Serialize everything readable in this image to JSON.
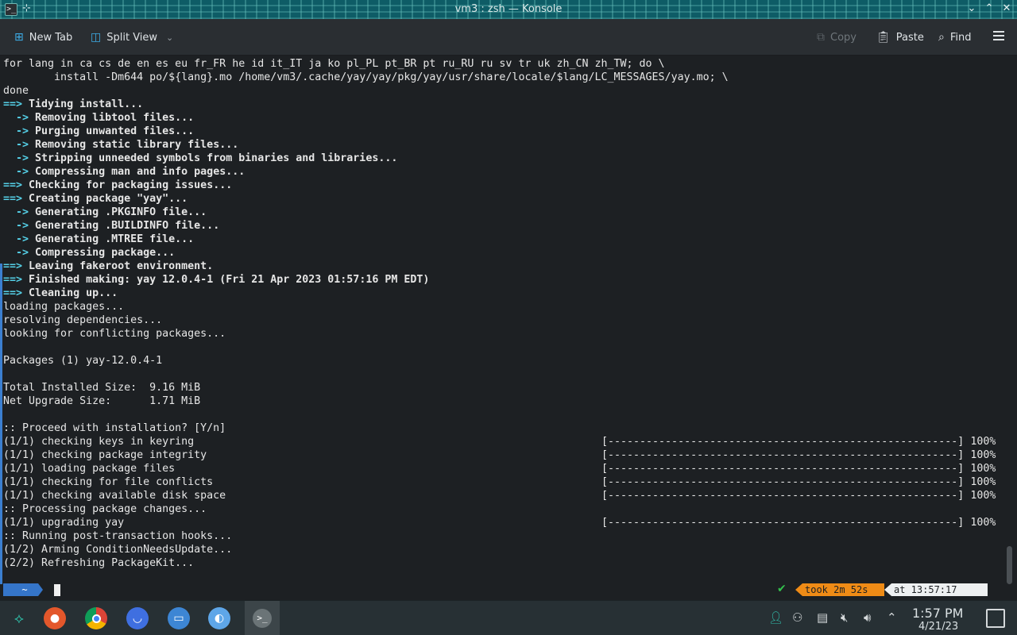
{
  "window": {
    "icon": ">_",
    "title": "vm3 : zsh — Konsole"
  },
  "toolbar": {
    "new_tab": "New Tab",
    "split_view": "Split View",
    "copy": "Copy",
    "paste": "Paste",
    "find": "Find"
  },
  "terminal": {
    "lines": [
      {
        "t": "plain",
        "text": "for lang in ca cs de en es eu fr_FR he id it_IT ja ko pl_PL pt_BR pt ru_RU ru sv tr uk zh_CN zh_TW; do \\"
      },
      {
        "t": "plain",
        "text": "        install -Dm644 po/${lang}.mo /home/vm3/.cache/yay/yay/pkg/yay/usr/share/locale/$lang/LC_MESSAGES/yay.mo; \\"
      },
      {
        "t": "plain",
        "text": "done"
      },
      {
        "t": "main",
        "marker": "==>",
        "text": " Tidying install..."
      },
      {
        "t": "sub",
        "marker": "  ->",
        "text": " Removing libtool files..."
      },
      {
        "t": "sub",
        "marker": "  ->",
        "text": " Purging unwanted files..."
      },
      {
        "t": "sub",
        "marker": "  ->",
        "text": " Removing static library files..."
      },
      {
        "t": "sub",
        "marker": "  ->",
        "text": " Stripping unneeded symbols from binaries and libraries..."
      },
      {
        "t": "sub",
        "marker": "  ->",
        "text": " Compressing man and info pages..."
      },
      {
        "t": "main",
        "marker": "==>",
        "text": " Checking for packaging issues..."
      },
      {
        "t": "main",
        "marker": "==>",
        "text": " Creating package \"yay\"..."
      },
      {
        "t": "sub",
        "marker": "  ->",
        "text": " Generating .PKGINFO file..."
      },
      {
        "t": "sub",
        "marker": "  ->",
        "text": " Generating .BUILDINFO file..."
      },
      {
        "t": "sub",
        "marker": "  ->",
        "text": " Generating .MTREE file..."
      },
      {
        "t": "sub",
        "marker": "  ->",
        "text": " Compressing package..."
      },
      {
        "t": "main",
        "marker": "==>",
        "text": " Leaving fakeroot environment."
      },
      {
        "t": "main",
        "marker": "==>",
        "text": " Finished making: yay 12.0.4-1 (Fri 21 Apr 2023 01:57:16 PM EDT)"
      },
      {
        "t": "main",
        "marker": "==>",
        "text": " Cleaning up..."
      },
      {
        "t": "plain",
        "text": "loading packages..."
      },
      {
        "t": "plain",
        "text": "resolving dependencies..."
      },
      {
        "t": "plain",
        "text": "looking for conflicting packages..."
      },
      {
        "t": "plain",
        "text": ""
      },
      {
        "t": "plain",
        "text": "Packages (1) yay-12.0.4-1"
      },
      {
        "t": "plain",
        "text": ""
      },
      {
        "t": "plain",
        "text": "Total Installed Size:  9.16 MiB"
      },
      {
        "t": "plain",
        "text": "Net Upgrade Size:      1.71 MiB"
      },
      {
        "t": "plain",
        "text": ""
      },
      {
        "t": "plain",
        "text": ":: Proceed with installation? [Y/n]"
      },
      {
        "t": "plain",
        "text": "(1/1) checking keys in keyring"
      },
      {
        "t": "plain",
        "text": "(1/1) checking package integrity"
      },
      {
        "t": "plain",
        "text": "(1/1) loading package files"
      },
      {
        "t": "plain",
        "text": "(1/1) checking for file conflicts"
      },
      {
        "t": "plain",
        "text": "(1/1) checking available disk space"
      },
      {
        "t": "plain",
        "text": ":: Processing package changes..."
      },
      {
        "t": "plain",
        "text": "(1/1) upgrading yay"
      },
      {
        "t": "plain",
        "text": ":: Running post-transaction hooks..."
      },
      {
        "t": "plain",
        "text": "(1/2) Arming ConditionNeedsUpdate..."
      },
      {
        "t": "plain",
        "text": "(2/2) Refreshing PackageKit..."
      }
    ],
    "progress_bars": [
      {
        "line": 28,
        "text": "[-------------------------------------------------------] 100%"
      },
      {
        "line": 29,
        "text": "[-------------------------------------------------------] 100%"
      },
      {
        "line": 30,
        "text": "[-------------------------------------------------------] 100%"
      },
      {
        "line": 31,
        "text": "[-------------------------------------------------------] 100%"
      },
      {
        "line": 32,
        "text": "[-------------------------------------------------------] 100%"
      },
      {
        "line": 34,
        "text": "[-------------------------------------------------------] 100%"
      }
    ]
  },
  "prompt": {
    "dir": "~",
    "took": "took 2m 52s",
    "at": "at 13:57:17"
  },
  "taskbar": {
    "clock_time": "1:57 PM",
    "clock_date": "4/21/23"
  },
  "colors": {
    "accent": "#3daee9",
    "arrow": "#55d1e8",
    "took_segment": "#ef8b16",
    "dir_segment": "#3575c9",
    "success": "#33c24d"
  }
}
